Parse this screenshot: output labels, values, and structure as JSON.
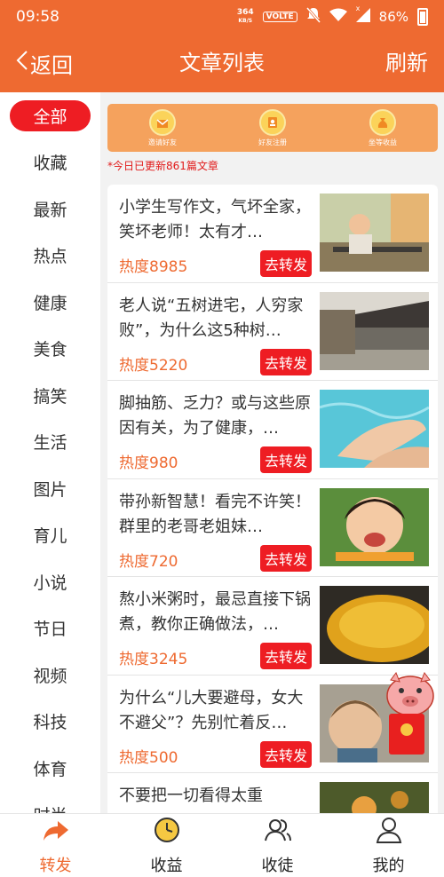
{
  "status": {
    "time": "09:58",
    "net_speed_value": "364",
    "net_speed_unit": "KB/S",
    "volte": "VOLTE",
    "x_mark": "x",
    "battery": "86%"
  },
  "header": {
    "back_label": "返回",
    "title": "文章列表",
    "refresh_label": "刷新"
  },
  "sidebar": {
    "items": [
      {
        "label": "全部",
        "active": true
      },
      {
        "label": "收藏"
      },
      {
        "label": "最新"
      },
      {
        "label": "热点"
      },
      {
        "label": "健康"
      },
      {
        "label": "美食"
      },
      {
        "label": "搞笑"
      },
      {
        "label": "生活"
      },
      {
        "label": "图片"
      },
      {
        "label": "育儿"
      },
      {
        "label": "小说"
      },
      {
        "label": "节日"
      },
      {
        "label": "视频"
      },
      {
        "label": "科技"
      },
      {
        "label": "体育"
      },
      {
        "label": "时尚"
      }
    ]
  },
  "banner": {
    "items": [
      {
        "label": "邀请好友",
        "icon": "invite-icon"
      },
      {
        "label": "好友注册",
        "icon": "register-icon"
      },
      {
        "label": "坐等收益",
        "icon": "money-bag-icon"
      }
    ]
  },
  "update_note": "*今日已更新861篇文章",
  "articles": [
    {
      "title": "小学生写作文，气坏全家，笑坏老师！太有才…",
      "heat": "热度8985",
      "share": "去转发",
      "image": "child-on-bench-photo"
    },
    {
      "title": "老人说“五树进宅，人穷家败”，为什么这5种树…",
      "heat": "热度5220",
      "share": "去转发",
      "image": "old-courtyard-photo"
    },
    {
      "title": "脚抽筋、乏力？或与这些原因有关，为了健康，…",
      "heat": "热度980",
      "share": "去转发",
      "image": "feet-in-water-photo"
    },
    {
      "title": "带孙新智慧！看完不许笑！群里的老哥老姐妹…",
      "heat": "热度720",
      "share": "去转发",
      "image": "laughing-girl-photo"
    },
    {
      "title": "熬小米粥时，最忌直接下锅煮，教你正确做法，…",
      "heat": "热度3245",
      "share": "去转发",
      "image": "millet-photo"
    },
    {
      "title": "为什么“儿大要避母，女大不避父”？先别忙着反…",
      "heat": "热度500",
      "share": "去转发",
      "image": "boy-photo"
    },
    {
      "title": "不要把一切看得太重",
      "heat": "",
      "share": "",
      "image": "autumn-photo"
    }
  ],
  "tabbar": {
    "items": [
      {
        "label": "转发",
        "icon": "share-arrow-icon",
        "active": true
      },
      {
        "label": "收益",
        "icon": "clock-icon"
      },
      {
        "label": "收徒",
        "icon": "people-icon"
      },
      {
        "label": "我的",
        "icon": "person-icon"
      }
    ]
  },
  "colors": {
    "accent": "#ee6a31",
    "red": "#ee1d23",
    "banner": "#f5a25d"
  }
}
